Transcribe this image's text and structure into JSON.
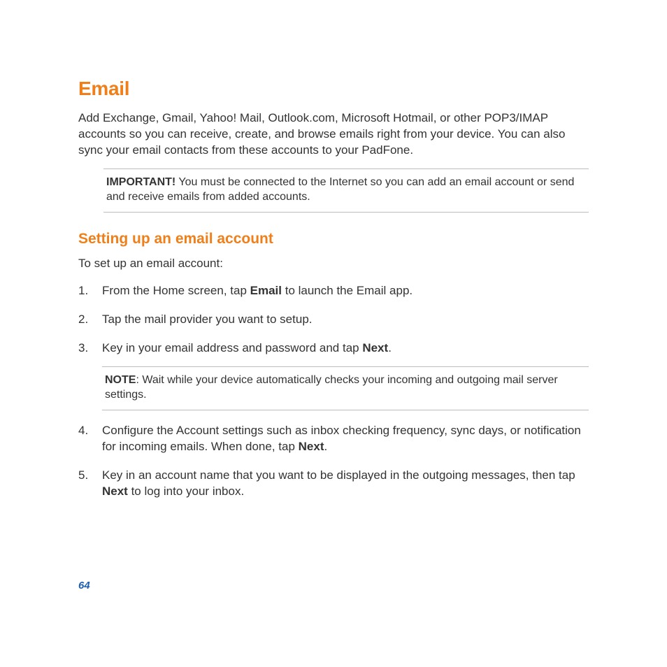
{
  "title": "Email",
  "intro": "Add Exchange, Gmail, Yahoo! Mail, Outlook.com, Microsoft Hotmail, or other POP3/IMAP accounts so you can receive, create, and browse emails right from your device. You can also sync your email contacts from these accounts to your PadFone.",
  "important": {
    "label": "IMPORTANT!",
    "text": " You must be connected to the Internet so you can add an email account or send and receive emails from added accounts."
  },
  "subhead": "Setting up an email account",
  "lead": "To set up an email account:",
  "steps": [
    {
      "n": "1.",
      "pre": "From the Home screen, tap ",
      "bold": "Email",
      "post": " to launch the Email app."
    },
    {
      "n": "2.",
      "pre": "Tap the mail provider you want to setup.",
      "bold": "",
      "post": ""
    },
    {
      "n": "3.",
      "pre": "Key in your email address and password and tap ",
      "bold": "Next",
      "post": ".",
      "note": {
        "label": "NOTE",
        "text": ": Wait while your device automatically checks your incoming and outgoing mail server settings."
      }
    },
    {
      "n": "4.",
      "pre": "Configure the Account settings such as inbox checking frequency, sync days, or notification for incoming emails. When done, tap ",
      "bold": "Next",
      "post": "."
    },
    {
      "n": "5.",
      "pre": "Key in an account name that you want to be displayed in the outgoing messages, then tap ",
      "bold": "Next",
      "post": " to log into your inbox."
    }
  ],
  "page_number": "64"
}
